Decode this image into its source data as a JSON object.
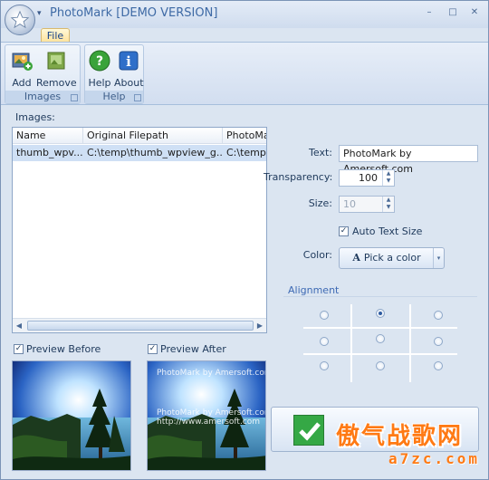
{
  "window": {
    "title": "PhotoMark [DEMO VERSION]",
    "minimize": "–",
    "maximize": "□",
    "close": "✕"
  },
  "ribbon": {
    "tab": "File",
    "groups": [
      {
        "label": "Images",
        "buttons": [
          {
            "label": "Add",
            "icon": "add-image-icon"
          },
          {
            "label": "Remove",
            "icon": "remove-image-icon"
          }
        ]
      },
      {
        "label": "Help",
        "buttons": [
          {
            "label": "Help",
            "icon": "help-icon"
          },
          {
            "label": "About",
            "icon": "about-icon"
          }
        ]
      }
    ]
  },
  "images": {
    "caption": "Images:",
    "columns": [
      "Name",
      "Original Filepath",
      "PhotoMar"
    ],
    "rows": [
      [
        "thumb_wpv...",
        "C:\\temp\\thumb_wpview_g...",
        "C:\\temp\\t"
      ]
    ]
  },
  "previews": {
    "before_label": "Preview Before",
    "after_label": "Preview After",
    "before_checked": true,
    "after_checked": true,
    "watermark_top": "PhotoMark by Amersoft.com",
    "watermark_mid": "PhotoMark by Amersoft.com",
    "watermark_bottom": "http://www.amersoft.com"
  },
  "settings": {
    "text_label": "Text:",
    "text_value": "PhotoMark by Amersoft.com",
    "transparency_label": "Transparency:",
    "transparency_value": "100",
    "size_label": "Size:",
    "size_value": "10",
    "auto_text_size_label": "Auto Text Size",
    "auto_text_size_checked": true,
    "color_label": "Color:",
    "color_button": "Pick a color",
    "alignment_caption": "Alignment",
    "alignment_selected": "top-center"
  },
  "overlay_logo": {
    "text_cn": "傲气战歌网",
    "text_url": "a7zc.com"
  },
  "colors": {
    "title": "#3e6aa5",
    "accent": "#3e6ab4",
    "selection": "#cfe0f5",
    "logo": "#ff7a14"
  }
}
